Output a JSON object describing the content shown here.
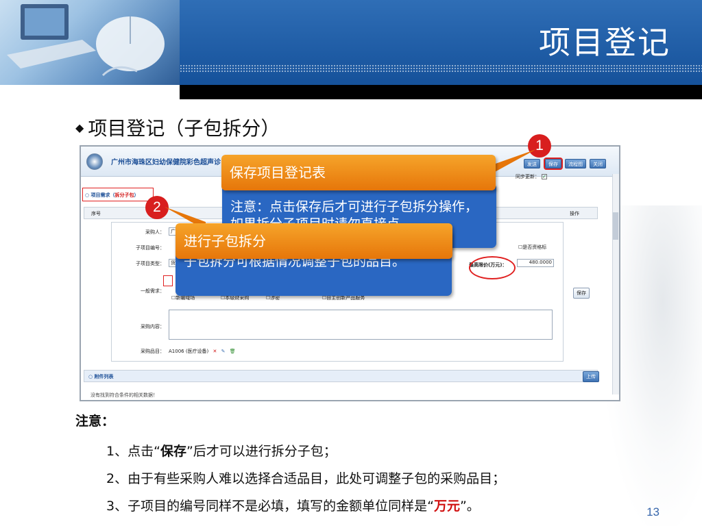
{
  "slide": {
    "title": "项目登记",
    "subtitle": "项目登记（子包拆分）",
    "bullet": "◆",
    "page_number": "13"
  },
  "screenshot": {
    "app_title": "广州市海珠区妇幼保健院彩色超声诊",
    "toolbar": {
      "send": "发送",
      "save": "保存",
      "flow": "流程图",
      "close": "关闭"
    },
    "sync_label": "同步更新：",
    "sync_checked": true,
    "section_title_prefix": "○ 项目需求（",
    "section_title_link": "拆分子包",
    "section_title_suffix": "）",
    "grid_headers": {
      "seq": "序号",
      "action": "操作"
    },
    "form": {
      "purchaser_label": "采购人：",
      "purchaser_value": "广",
      "subitem_no_label": "子项目编号：",
      "subitem_type_label": "子项目类型：",
      "subitem_type_value": "货",
      "general_need_label": "一般需求：",
      "opt_import": "新编域场",
      "opt_self": "本级财采购",
      "opt_group": "涉密",
      "opt_energy": "自主创新产品服务",
      "quality_mark_label": "是否资格标",
      "max_price_label": "最高限价(万元)：",
      "max_price_value": "480.0000",
      "content_label": "采购内容：",
      "item_label": "采购品目：",
      "item_value": "A1006 (医疗设备)",
      "save_row_button": "保存"
    },
    "attach_title": "○ 附件列表",
    "upload_button": "上传",
    "no_data": "没有找到符合条件的相关数据！"
  },
  "callouts": {
    "badge1": "1",
    "badge2": "2",
    "save_title": "保存项目登记表",
    "save_note": "注意：点击保存后才可进行子包拆分操作，如果拆分子项目时请勿直接点",
    "split_title": "进行子包拆分",
    "split_note": "子包拆分可根据情况调整子包的品目。"
  },
  "notes": {
    "label": "注意：",
    "n1_prefix": "1、点击“",
    "n1_bold": "保存",
    "n1_suffix": "”后才可以进行拆分子包；",
    "n2": "2、由于有些采购人难以选择合适品目，此处可调整子包的采购品目；",
    "n3_prefix": "3、子项目的编号同样不是必填，填写的金额单位同样是“",
    "n3_red": "万元",
    "n3_suffix": "”。"
  },
  "colors": {
    "header_blue": "#15519a",
    "callout_orange": "#e6760a",
    "callout_blue": "#2a67c2",
    "badge_red": "#d81e1e",
    "accent_red": "#d01010"
  }
}
